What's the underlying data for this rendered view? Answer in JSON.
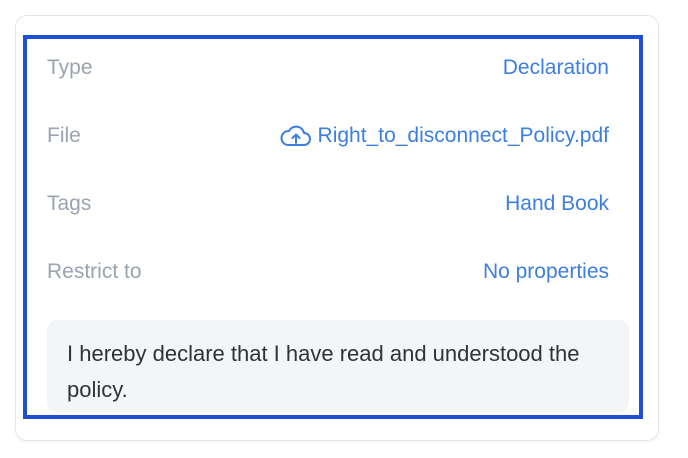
{
  "details": {
    "type": {
      "label": "Type",
      "value": "Declaration"
    },
    "file": {
      "label": "File",
      "value": "Right_to_disconnect_Policy.pdf",
      "icon": "cloud-upload-icon"
    },
    "tags": {
      "label": "Tags",
      "value": "Hand Book"
    },
    "restrict": {
      "label": "Restrict to",
      "value": "No properties"
    }
  },
  "declaration": {
    "text": "I hereby declare that I have read and understood the policy."
  },
  "colors": {
    "label": "#9aa3b0",
    "link": "#3d7fe0",
    "highlight_border": "#1f4fd6",
    "declaration_bg": "#f4f5f7",
    "text_dark": "#2f3338"
  }
}
